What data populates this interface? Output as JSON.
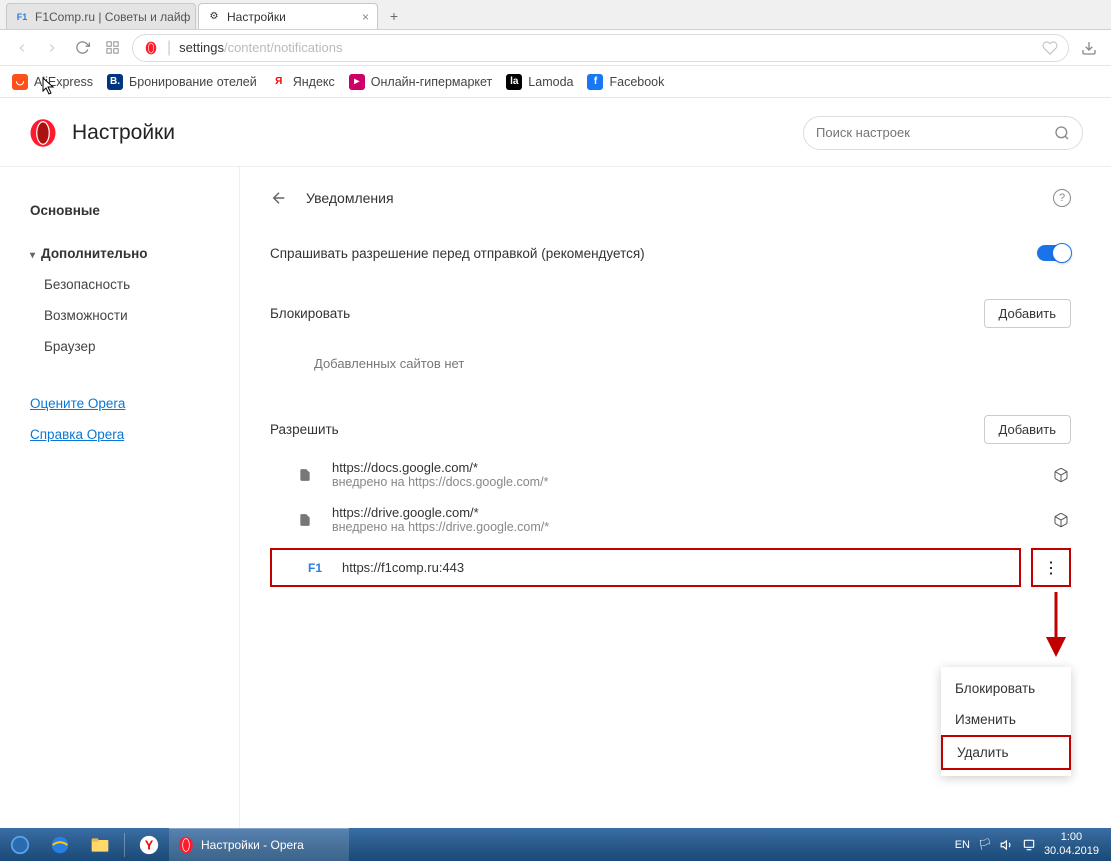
{
  "window": {
    "tabs": [
      {
        "title": "F1Comp.ru | Советы и лайф",
        "active": false
      },
      {
        "title": "Настройки",
        "active": true
      }
    ]
  },
  "addressbar": {
    "prefix": "settings",
    "path": "/content/notifications"
  },
  "bookmarks": [
    {
      "label": "AliExpress",
      "color": "#ff4f1b"
    },
    {
      "label": "Бронирование отелей",
      "color": "#003580"
    },
    {
      "label": "Яндекс",
      "color": "#ffcc00"
    },
    {
      "label": "Онлайн-гипермаркет",
      "color": "#cc0066"
    },
    {
      "label": "Lamoda",
      "color": "#000000"
    },
    {
      "label": "Facebook",
      "color": "#1877f2"
    }
  ],
  "page": {
    "title": "Настройки",
    "search_placeholder": "Поиск настроек"
  },
  "sidebar": {
    "basic": "Основные",
    "advanced": "Дополнительно",
    "sub": [
      "Безопасность",
      "Возможности",
      "Браузер"
    ],
    "links": [
      "Оцените Opera",
      "Справка Opera"
    ]
  },
  "notifications": {
    "heading": "Уведомления",
    "ask_label": "Спрашивать разрешение перед отправкой (рекомендуется)",
    "block": {
      "title": "Блокировать",
      "add": "Добавить",
      "empty": "Добавленных сайтов нет"
    },
    "allow": {
      "title": "Разрешить",
      "add": "Добавить",
      "sites": [
        {
          "url": "https://docs.google.com/*",
          "sub": "внедрено на https://docs.google.com/*"
        },
        {
          "url": "https://drive.google.com/*",
          "sub": "внедрено на https://drive.google.com/*"
        },
        {
          "url": "https://f1comp.ru:443",
          "sub": ""
        }
      ]
    }
  },
  "context_menu": {
    "items": [
      "Блокировать",
      "Изменить",
      "Удалить"
    ]
  },
  "taskbar": {
    "app": "Настройки - Opera",
    "lang": "EN",
    "time": "1:00",
    "date": "30.04.2019"
  }
}
